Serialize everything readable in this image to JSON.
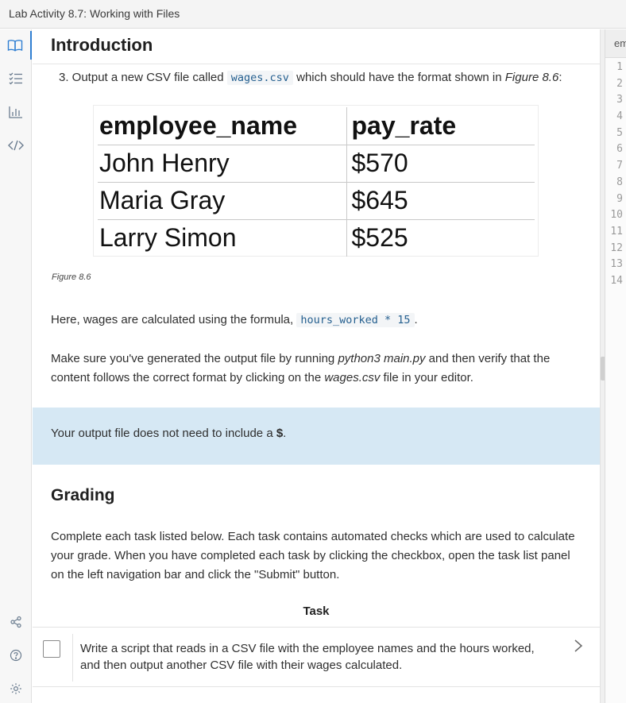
{
  "window": {
    "title": "Lab Activity 8.7: Working with Files"
  },
  "sidebar": {
    "icons": [
      "book-icon",
      "checklist-icon",
      "bar-chart-icon",
      "code-icon",
      "share-icon",
      "help-icon",
      "settings-icon"
    ]
  },
  "header": {
    "title": "Introduction"
  },
  "step3": {
    "prefix": "3. Output a new CSV file called ",
    "filename": "wages.csv",
    "middle": " which should have the format shown in ",
    "figure_ref": "Figure 8.6",
    "suffix": ":"
  },
  "figure": {
    "columns": [
      "employee_name",
      "pay_rate"
    ],
    "rows": [
      [
        "John Henry",
        "$570"
      ],
      [
        "Maria Gray",
        "$645"
      ],
      [
        "Larry Simon",
        "$525"
      ]
    ],
    "caption": "Figure 8.6"
  },
  "formula_para": {
    "prefix": "Here, wages are calculated using the formula, ",
    "code": "hours_worked * 15",
    "suffix": "."
  },
  "verify_para": {
    "t1": "Make sure you've generated the output file by running ",
    "cmd": "python3 main.py",
    "t2": " and then verify that the content follows the correct format by clicking on the ",
    "file": "wages.csv",
    "t3": " file in your editor."
  },
  "notice": {
    "text": "Your output file does not need to include a ",
    "symbol": "$",
    "end": "."
  },
  "grading": {
    "title": "Grading",
    "description": "Complete each task listed below. Each task contains automated checks which are used to calculate your grade. When you have completed each task by clicking the checkbox, open the task list panel on the left navigation bar and click the \"Submit\" button."
  },
  "tasks": {
    "header": "Task",
    "items": [
      {
        "text": "Write a script that reads in a CSV file with the employee names and the hours worked, and then output another CSV file with their wages calculated.",
        "checked": false
      }
    ]
  },
  "editor": {
    "tab_label": "employee_hours.csv",
    "line_numbers": [
      "1",
      "2",
      "3",
      "4",
      "5",
      "6",
      "7",
      "8",
      "9",
      "10",
      "11",
      "12",
      "13",
      "14"
    ]
  },
  "colors": {
    "accent": "#2f7fd2",
    "notice_bg": "#d6e8f4",
    "code_text": "#245f8f"
  }
}
